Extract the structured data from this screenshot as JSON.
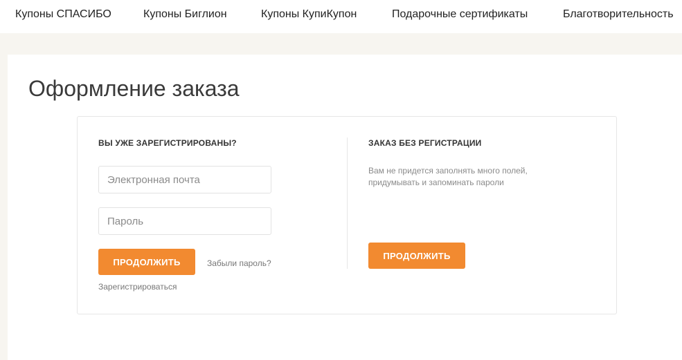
{
  "nav": {
    "items": [
      "Купоны СПАСИБО",
      "Купоны Биглион",
      "Купоны КупиКупон",
      "Подарочные сертификаты",
      "Благотворительность"
    ]
  },
  "page": {
    "title": "Оформление заказа"
  },
  "login": {
    "heading": "ВЫ УЖЕ ЗАРЕГИСТРИРОВАНЫ?",
    "email_placeholder": "Электронная почта",
    "password_placeholder": "Пароль",
    "continue_label": "ПРОДОЛЖИТЬ",
    "forgot_label": "Забыли пароль?",
    "register_label": "Зарегистрироваться"
  },
  "guest": {
    "heading": "ЗАКАЗ БЕЗ РЕГИСТРАЦИИ",
    "description": "Вам не придется заполнять много полей, придумывать и запоминать пароли",
    "continue_label": "ПРОДОЛЖИТЬ"
  },
  "colors": {
    "accent": "#f28a30",
    "band": "#f7f5f0"
  }
}
